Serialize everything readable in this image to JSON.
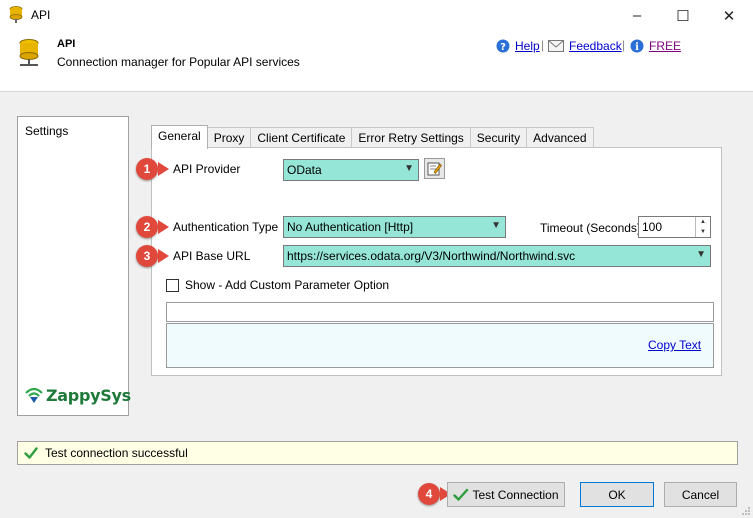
{
  "window": {
    "title": "API",
    "minimize_label": "–",
    "maximize_label": "☐",
    "close_label": "✕"
  },
  "header": {
    "title": "API",
    "subtitle": "Connection manager for Popular API services",
    "help_label": "Help",
    "feedback_label": "Feedback",
    "free_label": "FREE",
    "divider": "|"
  },
  "sidebar": {
    "items": [
      "Settings"
    ],
    "logo_text": "ZappySys"
  },
  "tabs": [
    "General",
    "Proxy",
    "Client Certificate",
    "Error Retry Settings",
    "Security",
    "Advanced"
  ],
  "form": {
    "api_provider": {
      "label": "API Provider",
      "value": "OData"
    },
    "auth_type": {
      "label": "Authentication Type",
      "value": "No Authentication [Http]"
    },
    "timeout": {
      "label": "Timeout (Seconds)",
      "value": "100"
    },
    "api_base_url": {
      "label": "API Base URL",
      "value": "https://services.odata.org/V3/Northwind/Northwind.svc"
    },
    "show_params": {
      "label": "Show - Add Custom Parameter Option",
      "checked": false
    },
    "param_value": "",
    "copy_text_label": "Copy Text"
  },
  "callouts": [
    "1",
    "2",
    "3",
    "4"
  ],
  "status": {
    "text": "Test connection successful",
    "color": "#ffffe6"
  },
  "buttons": {
    "test": "Test Connection",
    "ok": "OK",
    "cancel": "Cancel"
  },
  "colors": {
    "combo": "#96e6d7",
    "badge": "#e0483c",
    "link": "#0000cc"
  }
}
